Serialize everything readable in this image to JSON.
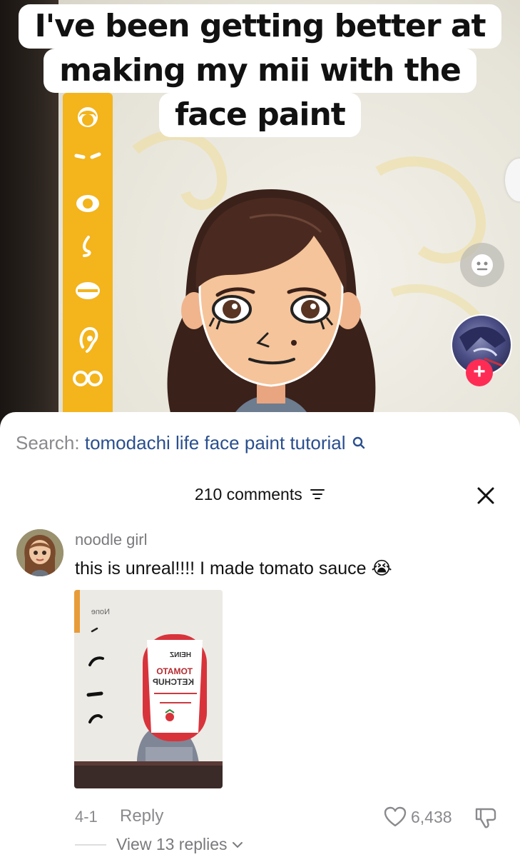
{
  "video": {
    "caption_lines": [
      "I've been getting better at",
      "making my mii with the",
      "face paint"
    ]
  },
  "search": {
    "label": "Search:",
    "query": "tomodachi life face paint tutorial"
  },
  "comments": {
    "count_label": "210 comments"
  },
  "comment": {
    "username": "noodle girl",
    "text": "this is unreal!!!! I made tomato sauce",
    "emoji": "😭",
    "image_label_none": "None",
    "image_ketchup_brand": "HEINZ",
    "image_ketchup_line1": "TOMATO",
    "image_ketchup_line2": "KETCHUP",
    "date": "4-1",
    "reply_label": "Reply",
    "likes": "6,438",
    "view_replies": "View 13 replies"
  },
  "icons": {
    "search": "search-icon",
    "sort": "sort-icon",
    "close": "close-icon",
    "like": "heart-icon",
    "dislike": "thumbs-down-icon",
    "chevron": "chevron-down-icon",
    "follow": "plus-icon"
  },
  "colors": {
    "accent_red": "#fe2c55",
    "search_query": "#2a4f8e",
    "yellow_bar": "#f3b41c"
  }
}
